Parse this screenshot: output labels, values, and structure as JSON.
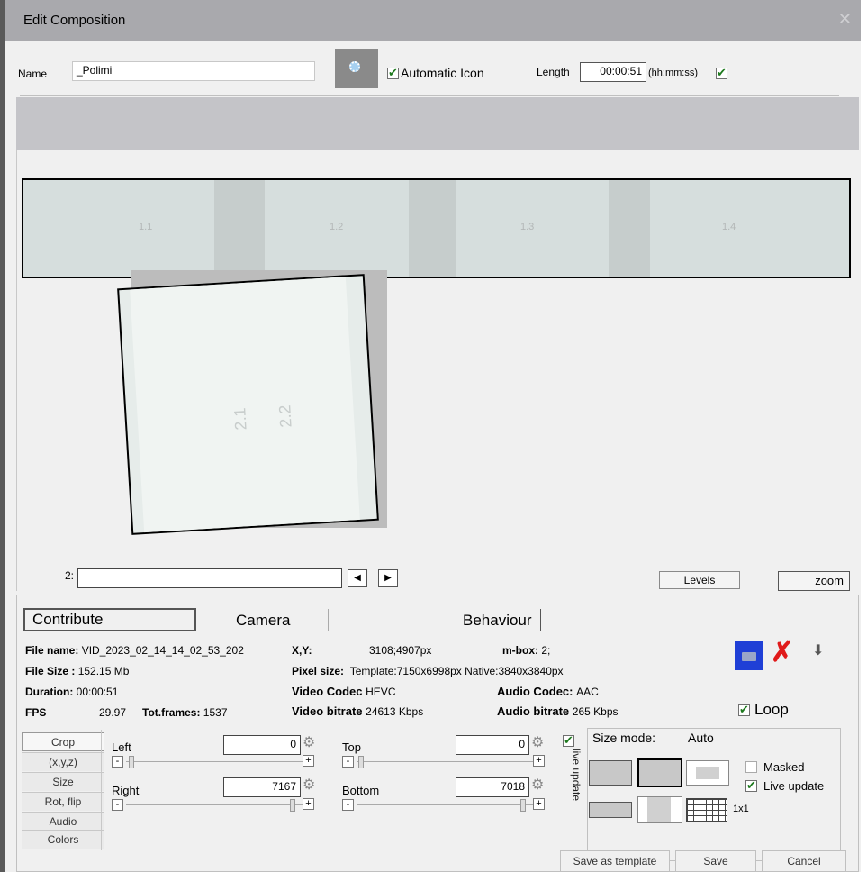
{
  "window": {
    "title": "Edit Composition",
    "close_glyph": "✕"
  },
  "name_row": {
    "name_label": "Name",
    "name_value": "_Polimi",
    "auto_icon_label": "Automatic Icon",
    "length_label": "Length",
    "length_value": "00:00:51",
    "length_unit": "(hh:mm:ss)"
  },
  "preview": {
    "tiles": [
      "1.1",
      "1.2",
      "1.3",
      "1.4"
    ],
    "tilted_labels": [
      "2.1",
      "2.2"
    ],
    "row_label": "2:",
    "levels_button": "Levels",
    "zoom_button": "zoom",
    "prev_glyph": "◀",
    "next_glyph": "▶"
  },
  "tabs": [
    "Contribute",
    "Camera",
    "Behaviour"
  ],
  "info": {
    "file_name_label": "File name:",
    "file_name_value": "VID_2023_02_14_14_02_53_202",
    "file_size_label": "File Size :",
    "file_size_value": "152.15 Mb",
    "duration_label": "Duration:",
    "duration_value": "00:00:51",
    "fps_label": "FPS",
    "fps_value": "29.97",
    "tot_frames_label": "Tot.frames:",
    "tot_frames_value": "1537",
    "xy_label": "X,Y:",
    "xy_value": "3108;4907px",
    "mbox_label": "m-box:",
    "mbox_value": "2;",
    "pixel_size_label": "Pixel size:",
    "pixel_size_value": "Template:7150x6998px Native:3840x3840px",
    "video_codec_label": "Video Codec",
    "video_codec_value": "HEVC",
    "audio_codec_label": "Audio Codec:",
    "audio_codec_value": "AAC",
    "video_bitrate_label": "Video bitrate",
    "video_bitrate_value": "24613 Kbps",
    "audio_bitrate_label": "Audio bitrate",
    "audio_bitrate_value": "265 Kbps",
    "loop_label": "Loop"
  },
  "side_buttons": [
    "Crop",
    "(x,y,z)",
    "Size",
    "Rot, flip",
    "Audio",
    "Colors"
  ],
  "crop": {
    "left_label": "Left",
    "left_value": "0",
    "top_label": "Top",
    "top_value": "0",
    "right_label": "Right",
    "right_value": "7167",
    "bottom_label": "Bottom",
    "bottom_value": "7018",
    "live_update_vertical": "live update",
    "minus": "-",
    "plus": "+"
  },
  "size_mode": {
    "label": "Size mode:",
    "value": "Auto",
    "masked_label": "Masked",
    "live_update_label": "Live update",
    "grid_label": "1x1"
  },
  "bottom_buttons": {
    "save_template": "Save as template",
    "save": "Save",
    "cancel": "Cancel"
  }
}
